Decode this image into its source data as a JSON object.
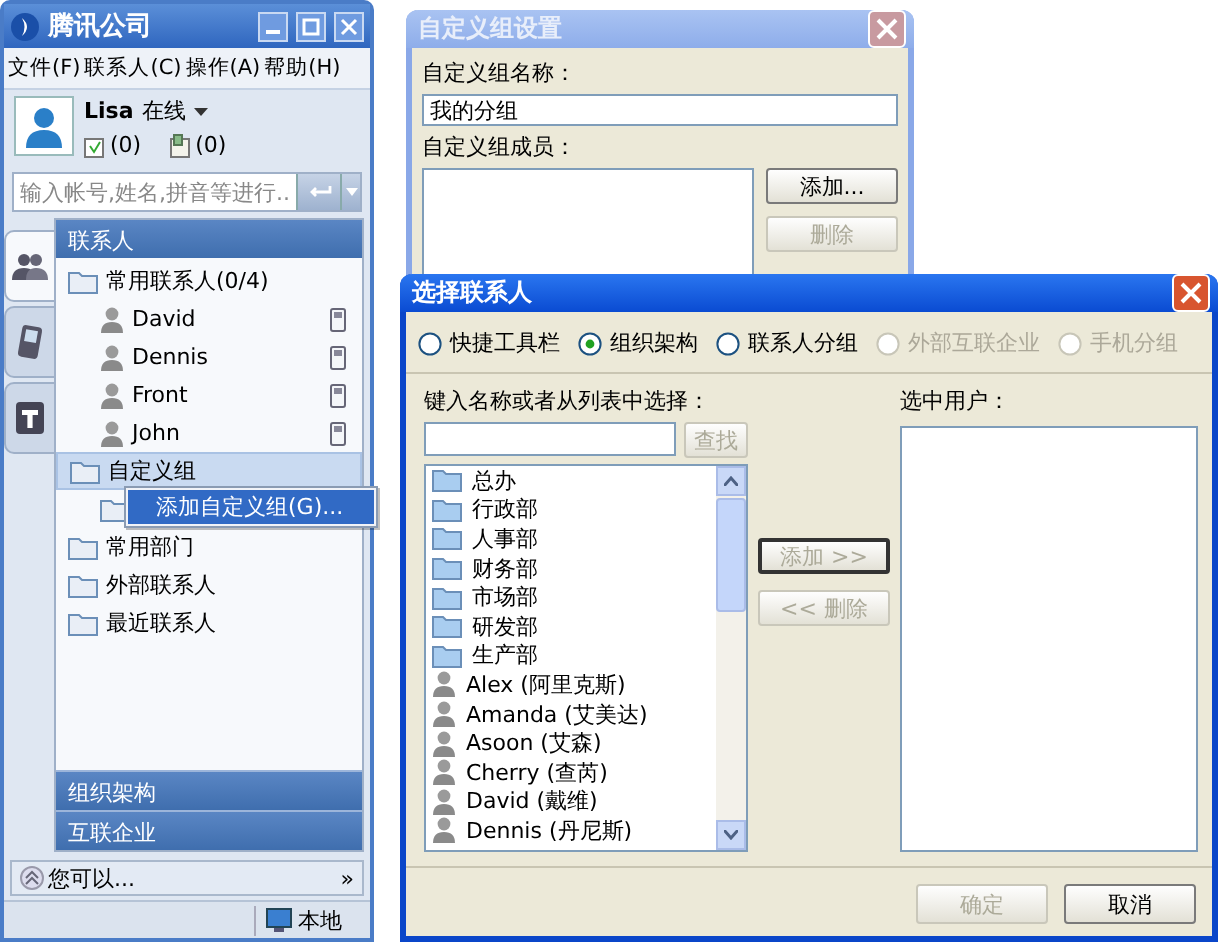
{
  "main_window": {
    "title": "腾讯公司",
    "menu": [
      "文件(F)",
      "联系人(C)",
      "操作(A)",
      "帮助(H)"
    ],
    "user": {
      "name": "Lisa",
      "status": "在线",
      "mail_count": "(0)",
      "file_count": "(0)"
    },
    "search": {
      "placeholder": "输入帐号,姓名,拼音等进行..."
    },
    "side_tabs": [
      {
        "kind": "contacts",
        "selected": true
      },
      {
        "kind": "phone",
        "selected": false
      },
      {
        "kind": "text",
        "selected": false
      }
    ],
    "list_header": "联系人",
    "tree": [
      {
        "kind": "group",
        "label": "常用联系人(0/4)",
        "selected": false,
        "children": [
          {
            "kind": "person",
            "label": "David",
            "selected": false
          },
          {
            "kind": "person",
            "label": "Dennis",
            "selected": false
          },
          {
            "kind": "person",
            "label": "Front",
            "selected": false
          },
          {
            "kind": "person",
            "label": "John",
            "selected": false
          }
        ]
      },
      {
        "kind": "group",
        "label": "自定义组",
        "selected": true,
        "children": [
          {
            "kind": "group",
            "selected": false
          }
        ]
      },
      {
        "kind": "group",
        "label": "常用部门",
        "selected": false
      },
      {
        "kind": "group",
        "label": "外部联系人",
        "selected": false
      },
      {
        "kind": "group",
        "label": "最近联系人",
        "selected": false
      }
    ],
    "sections": [
      "组织架构",
      "互联企业"
    ],
    "hint": "您可以...",
    "more": "»",
    "status": "本地"
  },
  "context_menu": {
    "items": [
      {
        "label": "添加自定义组(G)...",
        "selected": true
      }
    ]
  },
  "group_settings_dialog": {
    "title": "自定义组设置",
    "name_label": "自定义组名称：",
    "name_value": "我的分组",
    "members_label": "自定义组成员：",
    "buttons": [
      {
        "label": "添加...",
        "disabled": false
      },
      {
        "label": "删除",
        "disabled": true
      }
    ]
  },
  "select_contacts_dialog": {
    "title": "选择联系人",
    "sources": [
      {
        "label": "快捷工具栏",
        "selected": false,
        "disabled": false
      },
      {
        "label": "组织架构",
        "selected": true,
        "disabled": false
      },
      {
        "label": "联系人分组",
        "selected": false,
        "disabled": false
      },
      {
        "label": "外部互联企业",
        "selected": false,
        "disabled": true
      },
      {
        "label": "手机分组",
        "selected": false,
        "disabled": true
      }
    ],
    "search_label": "键入名称或者从列表中选择：",
    "find_button": {
      "label": "查找",
      "disabled": true
    },
    "list": [
      {
        "kind": "department",
        "label": "总办"
      },
      {
        "kind": "department",
        "label": "行政部"
      },
      {
        "kind": "department",
        "label": "人事部"
      },
      {
        "kind": "department",
        "label": "财务部"
      },
      {
        "kind": "department",
        "label": "市场部"
      },
      {
        "kind": "department",
        "label": "研发部"
      },
      {
        "kind": "department",
        "label": "生产部"
      },
      {
        "kind": "person",
        "label": "Alex (阿里克斯)"
      },
      {
        "kind": "person",
        "label": "Amanda (艾美达)"
      },
      {
        "kind": "person",
        "label": "Asoon (艾森)"
      },
      {
        "kind": "person",
        "label": "Cherry (查芮)"
      },
      {
        "kind": "person",
        "label": "David (戴维)"
      },
      {
        "kind": "person",
        "label": "Dennis (丹尼斯)"
      }
    ],
    "add_button": {
      "label": "添加 >>",
      "disabled": true
    },
    "remove_button": {
      "label": "<< 删除",
      "disabled": true
    },
    "selected_label": "选中用户：",
    "ok_button": {
      "label": "确定",
      "disabled": true
    },
    "cancel_button": {
      "label": "取消",
      "disabled": false
    }
  }
}
